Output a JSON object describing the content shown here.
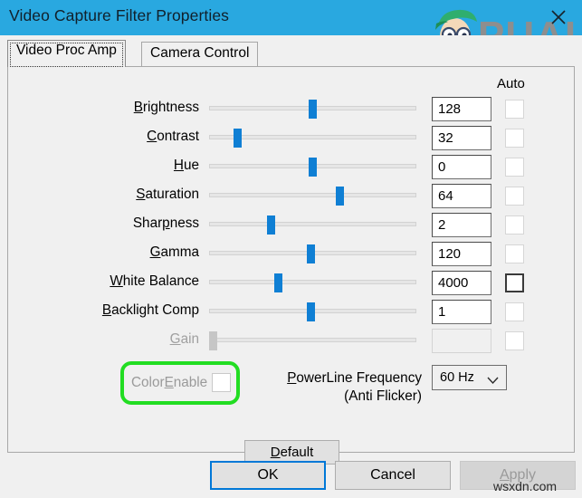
{
  "window": {
    "title": "Video Capture Filter Properties",
    "close_icon": "close-icon",
    "logo_text": "APPUALS"
  },
  "tabs": [
    {
      "label": "Video Proc Amp",
      "active": true
    },
    {
      "label": "Camera Control",
      "active": false
    }
  ],
  "columns": {
    "auto_header": "Auto"
  },
  "controls": [
    {
      "label_pre": "",
      "label_key": "B",
      "label_post": "rightness",
      "value": "128",
      "slider_pct": 50,
      "auto_checked": false,
      "auto_enabled": false,
      "disabled": false
    },
    {
      "label_pre": "",
      "label_key": "C",
      "label_post": "ontrast",
      "value": "32",
      "slider_pct": 13,
      "auto_checked": false,
      "auto_enabled": false,
      "disabled": false
    },
    {
      "label_pre": "",
      "label_key": "H",
      "label_post": "ue",
      "value": "0",
      "slider_pct": 50,
      "auto_checked": false,
      "auto_enabled": false,
      "disabled": false
    },
    {
      "label_pre": "",
      "label_key": "S",
      "label_post": "aturation",
      "value": "64",
      "slider_pct": 63,
      "auto_checked": false,
      "auto_enabled": false,
      "disabled": false
    },
    {
      "label_pre": "Shar",
      "label_key": "p",
      "label_post": "ness",
      "value": "2",
      "slider_pct": 29,
      "auto_checked": false,
      "auto_enabled": false,
      "disabled": false
    },
    {
      "label_pre": "",
      "label_key": "G",
      "label_post": "amma",
      "value": "120",
      "slider_pct": 49,
      "auto_checked": false,
      "auto_enabled": false,
      "disabled": false
    },
    {
      "label_pre": "",
      "label_key": "W",
      "label_post": "hite Balance",
      "value": "4000",
      "slider_pct": 33,
      "auto_checked": false,
      "auto_enabled": true,
      "disabled": false
    },
    {
      "label_pre": "",
      "label_key": "B",
      "label_post": "acklight Comp",
      "value": "1",
      "slider_pct": 49,
      "auto_checked": false,
      "auto_enabled": false,
      "disabled": false
    },
    {
      "label_pre": "",
      "label_key": "G",
      "label_post": "ain",
      "value": "",
      "slider_pct": 0,
      "auto_checked": false,
      "auto_enabled": false,
      "disabled": true
    }
  ],
  "color_enable": {
    "label_pre": "Color",
    "label_key": "E",
    "label_post": "nable",
    "checked": false,
    "disabled": true,
    "highlight_color": "#22dd22"
  },
  "powerline": {
    "label_line1_pre": "",
    "label_line1_key": "P",
    "label_line1_post": "owerLine Frequency",
    "label_line2": "(Anti Flicker)",
    "selected": "60 Hz",
    "chevron_icon": "chevron-down-icon"
  },
  "default_button": {
    "label_pre": "",
    "label_key": "D",
    "label_post": "efault"
  },
  "footer_buttons": [
    {
      "label": "OK",
      "state": "focused"
    },
    {
      "label": "Cancel",
      "state": "normal"
    },
    {
      "label": "Apply",
      "state": "disabled",
      "mnemonic": "A"
    }
  ],
  "watermark": "wsxdn.com",
  "colors": {
    "titlebar": "#29a8e0",
    "accent": "#0078d7",
    "thumb": "#0f7fd4",
    "panel": "#f0f0f0"
  }
}
